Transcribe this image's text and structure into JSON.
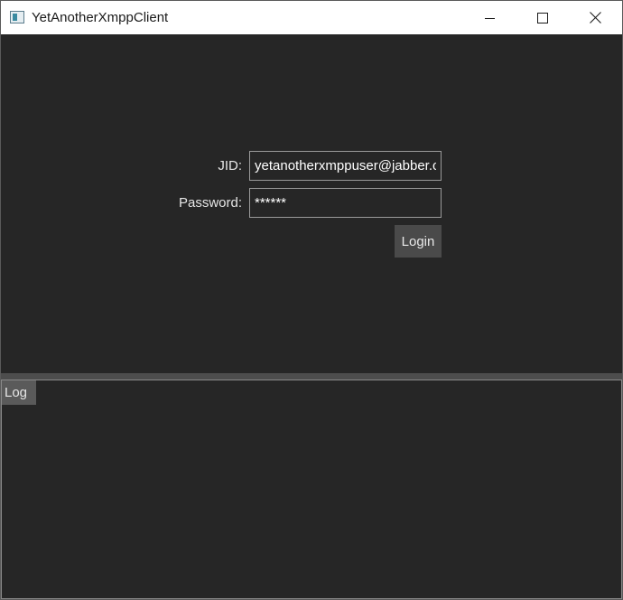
{
  "window": {
    "title": "YetAnotherXmppClient",
    "controls": {
      "minimize_icon": "minimize-icon",
      "maximize_icon": "maximize-icon",
      "close_icon": "close-icon"
    }
  },
  "login": {
    "jid_label": "JID:",
    "jid_value": "yetanotherxmppuser@jabber.c",
    "password_label": "Password:",
    "password_value": "******",
    "login_label": "Login"
  },
  "log": {
    "tab_label": "Log",
    "entries": []
  },
  "colors": {
    "background": "#262626",
    "input_border": "#9a9a9a",
    "button": "#4a4a4a",
    "splitter": "#4d4d4d",
    "log_tab": "#5a5a5a"
  }
}
